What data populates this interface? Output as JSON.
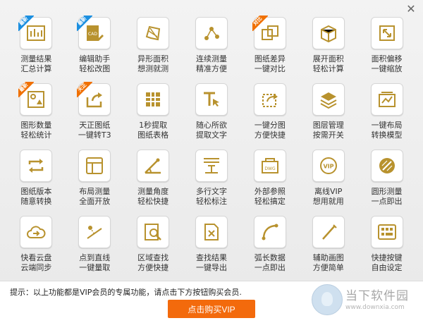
{
  "window": {
    "close_glyph": "✕"
  },
  "features": [
    {
      "icon": "measure-summary-icon",
      "line1": "测量结果",
      "line2": "汇总计算",
      "badge": "最新",
      "badge_color": "blue"
    },
    {
      "icon": "cad-edit-icon",
      "line1": "编辑助手",
      "line2": "轻松改图",
      "badge": "最新",
      "badge_color": "blue"
    },
    {
      "icon": "irregular-area-icon",
      "line1": "异形面积",
      "line2": "想测就测"
    },
    {
      "icon": "continuous-measure-icon",
      "line1": "连续测量",
      "line2": "精准方便"
    },
    {
      "icon": "drawing-diff-icon",
      "line1": "图纸差异",
      "line2": "一键对比",
      "badge": "对比",
      "badge_color": "orange"
    },
    {
      "icon": "unfold-area-icon",
      "line1": "展开面积",
      "line2": "轻松计算"
    },
    {
      "icon": "area-offset-icon",
      "line1": "面积偏移",
      "line2": "一键缩放"
    },
    {
      "icon": "shape-count-icon",
      "line1": "图形数量",
      "line2": "轻松统计",
      "badge": "最新",
      "badge_color": "orange"
    },
    {
      "icon": "tianzheng-convert-icon",
      "line1": "天正图纸",
      "line2": "一键转T3",
      "badge": "天正",
      "badge_color": "orange"
    },
    {
      "icon": "table-extract-icon",
      "line1": "1秒提取",
      "line2": "图纸表格"
    },
    {
      "icon": "text-extract-icon",
      "line1": "随心所欲",
      "line2": "提取文字"
    },
    {
      "icon": "split-drawing-icon",
      "line1": "一键分图",
      "line2": "方便快捷"
    },
    {
      "icon": "layer-manage-icon",
      "line1": "图层管理",
      "line2": "按需开关"
    },
    {
      "icon": "layout-convert-icon",
      "line1": "一键布局",
      "line2": "转换模型"
    },
    {
      "icon": "version-convert-icon",
      "line1": "图纸版本",
      "line2": "随意转换"
    },
    {
      "icon": "layout-icon",
      "line1": "布局测量",
      "line2": "全面开放"
    },
    {
      "icon": "angle-measure-icon",
      "line1": "测量角度",
      "line2": "轻松快捷"
    },
    {
      "icon": "multiline-text-icon",
      "line1": "多行文字",
      "line2": "轻松标注"
    },
    {
      "icon": "external-ref-icon",
      "line1": "外部参照",
      "line2": "轻松搞定"
    },
    {
      "icon": "vip-icon",
      "line1": "离线VIP",
      "line2": "想用就用"
    },
    {
      "icon": "circle-measure-icon",
      "line1": "圆形测量",
      "line2": "一点即出"
    },
    {
      "icon": "cloud-sync-icon",
      "line1": "快看云盘",
      "line2": "云端同步"
    },
    {
      "icon": "point-to-line-icon",
      "line1": "点到直线",
      "line2": "一键量取"
    },
    {
      "icon": "area-search-icon",
      "line1": "区域查找",
      "line2": "方便快捷"
    },
    {
      "icon": "export-results-icon",
      "line1": "查找结果",
      "line2": "一键导出"
    },
    {
      "icon": "arc-data-icon",
      "line1": "弧长数据",
      "line2": "一点即出"
    },
    {
      "icon": "auxiliary-draw-icon",
      "line1": "辅助画图",
      "line2": "方便简单"
    },
    {
      "icon": "shortcut-keys-icon",
      "line1": "快捷按键",
      "line2": "自由设定"
    }
  ],
  "hint": "提示：以上功能都是VIP会员的专属功能，请点击下方按钮购买会员.",
  "buy_button": "点击购买VIP",
  "watermark": {
    "name": "当下软件园",
    "url": "www.downxia.com"
  },
  "colors": {
    "icon": "#b8922e",
    "button": "#f36a0c",
    "badge_blue": "#1b8fe0",
    "badge_orange": "#f07000"
  }
}
